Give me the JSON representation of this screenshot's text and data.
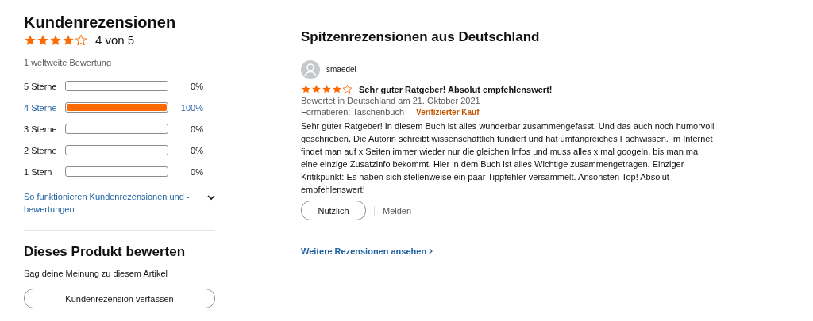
{
  "summary": {
    "title": "Kundenrezensionen",
    "stars": 4,
    "rating": "4 von 5",
    "count": "1 weltweite Bewertung",
    "histogram": [
      {
        "label": "5 Sterne",
        "level": 0,
        "percent": "0%",
        "active": false
      },
      {
        "label": "4 Sterne",
        "level": 1,
        "percent": "100%",
        "active": true
      },
      {
        "label": "3 Sterne",
        "level": 0,
        "percent": "0%",
        "active": false
      },
      {
        "label": "2 Sterne",
        "level": 0,
        "percent": "0%",
        "active": false
      },
      {
        "label": "1 Stern",
        "level": 0,
        "percent": "0%",
        "active": false
      }
    ],
    "help_link": "So funktionieren Kundenrezensionen und -bewertungen",
    "help_expanded": false
  },
  "rate": {
    "title": "Dieses Produkt bewerten",
    "text": "Sag deine Meinung zu diesem Artikel",
    "button": "Kundenrezension verfassen"
  },
  "reviews": {
    "title": "Spitzenrezensionen aus Deutschland",
    "items": [
      {
        "author": "smaedel",
        "stars": 4,
        "headline": "Sehr guter Ratgeber! Absolut empfehlenswert!",
        "date": "Bewertet in Deutschland am 21. Oktober 2021",
        "format": "Formatieren: Taschenbuch",
        "badge": "Verifizierter Kauf",
        "body": "Sehr guter Ratgeber! In diesem Buch ist alles wunderbar zusammengefasst. Und das auch noch humorvoll geschrieben. Die Autorin schreibt wissenschaftlich fundiert und hat umfangreiches Fachwissen. Im Internet findet man auf x Seiten immer wieder nur die gleichen Infos und muss alles x mal googeln, bis man mal eine einzige Zusatzinfo bekommt. Hier in dem Buch ist alles Wichtige zusammengetragen. Einziger Kritikpunkt: Es haben sich stellenweise ein paar Tippfehler versammelt. Ansonsten Top! Absolut empfehlenswert!",
        "helpful": "Nützlich",
        "report": "Melden"
      }
    ],
    "more": "Weitere Rezensionen ansehen"
  }
}
